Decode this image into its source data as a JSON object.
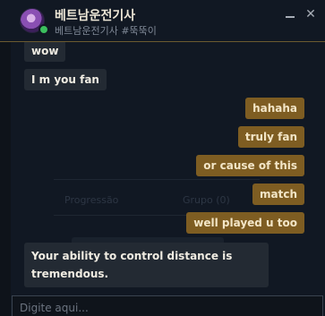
{
  "header": {
    "name": "베트남운전기사",
    "riot_id": "베트남운전기사 #뚝뚝이",
    "minimize_icon": "minimize-icon",
    "close_icon": "close-icon",
    "close_glyph": "✕"
  },
  "background": {
    "tab_progress": "Progressão",
    "tab_group": "Grupo (0)"
  },
  "messages": [
    {
      "direction": "in",
      "text": "wow"
    },
    {
      "direction": "in",
      "text": "I m you fan"
    },
    {
      "direction": "out",
      "text": "hahaha"
    },
    {
      "direction": "out",
      "text": "truly fan"
    },
    {
      "direction": "out",
      "text": "or cause of this"
    },
    {
      "direction": "out",
      "text": "match"
    },
    {
      "direction": "out",
      "text": "well played u too"
    },
    {
      "direction": "in",
      "text": "Your ability to control distance is tremendous."
    }
  ],
  "input": {
    "placeholder": "Digite aqui...",
    "value": ""
  },
  "colors": {
    "incoming_bubble": "#232a33",
    "outgoing_bubble": "#7e5d22",
    "online_status": "#3bbf5d",
    "header_border": "#6b5a30"
  }
}
